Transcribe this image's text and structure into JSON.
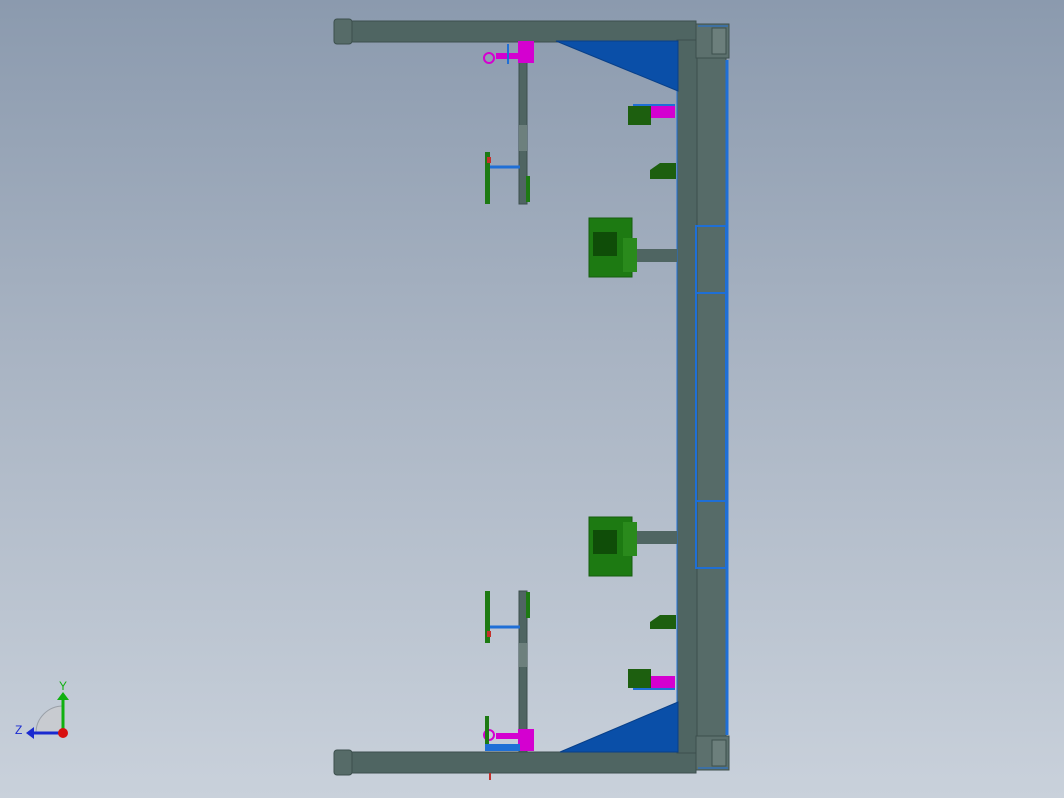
{
  "viewport": {
    "background_top": "#8b9aae",
    "background_bottom": "#c9d1db"
  },
  "model": {
    "frame_color": "#4d6360",
    "accent_blue": "#1f6fd6",
    "plate_blue": "#0a4fa8",
    "clamp_green": "#1d7a12",
    "fastener_magenta": "#d400d0"
  },
  "triad": {
    "y_label": "Y",
    "z_label": "Z",
    "y_color": "#10b010",
    "z_color": "#1a2ad0",
    "x_color": "#d81010"
  }
}
